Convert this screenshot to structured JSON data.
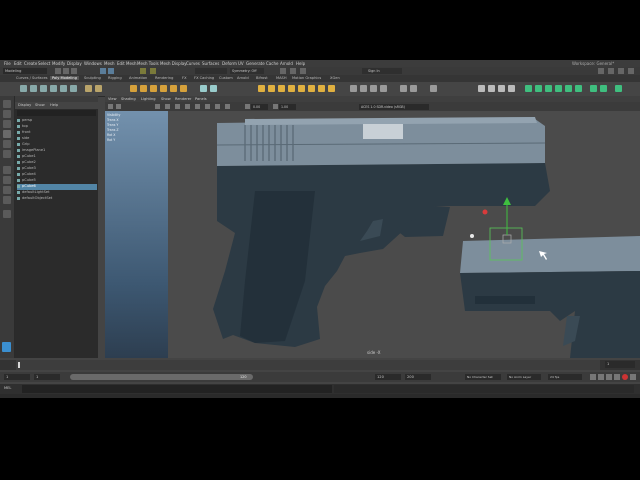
{
  "app": {
    "workspace_value": "Modeling",
    "symmetry_value": "Symmetry: Off",
    "user_value": "Sign In",
    "workspace_right": "Workspace: General*"
  },
  "menubar": [
    "File",
    "Edit",
    "Create",
    "Select",
    "Modify",
    "Display",
    "Windows",
    "Mesh",
    "Edit Mesh",
    "Mesh Tools",
    "Mesh Display",
    "Curves",
    "Surfaces",
    "Deform",
    "UV",
    "Generate",
    "Cache",
    "Arnold",
    "Help"
  ],
  "shelf_tabs": [
    "Curves / Surfaces",
    "Poly Modeling",
    "Sculpting",
    "Rigging",
    "Animation",
    "Rendering",
    "FX",
    "FX Caching",
    "Custom",
    "Arnold",
    "Bifrost",
    "MASH",
    "Motion Graphics",
    "XGen"
  ],
  "outliner": {
    "menu": [
      "Display",
      "Show",
      "Help"
    ],
    "items": [
      {
        "label": "persp",
        "selected": false
      },
      {
        "label": "top",
        "selected": false
      },
      {
        "label": "front",
        "selected": false
      },
      {
        "label": "side",
        "selected": false
      },
      {
        "label": "Grip",
        "selected": false
      },
      {
        "label": "imagePlane1",
        "selected": false
      },
      {
        "label": "pCube1",
        "selected": false
      },
      {
        "label": "pCube2",
        "selected": false
      },
      {
        "label": "pCube3",
        "selected": false
      },
      {
        "label": "pCube4",
        "selected": false
      },
      {
        "label": "pCube5",
        "selected": false
      },
      {
        "label": "pCube6",
        "selected": true
      },
      {
        "label": "defaultLightSet",
        "selected": false
      },
      {
        "label": "defaultObjectSet",
        "selected": false
      }
    ]
  },
  "viewport": {
    "menu": [
      "View",
      "Shading",
      "Lighting",
      "Show",
      "Renderer",
      "Panels"
    ],
    "camera_label": "side -X",
    "field_a": "0.00",
    "field_b": "1.00",
    "colorspace": "ACES 1.0 SDR-video (sRGB)",
    "channel_rows": [
      "Visibility",
      "Trans X",
      "Trans Y",
      "Trans Z",
      "Rot X",
      "Rot Y"
    ]
  },
  "timeline": {
    "start": "1",
    "end": "120",
    "current": "1",
    "range_end": "120",
    "range_end2": "200",
    "char_set": "No Character Set",
    "anim_layer": "No Anim Layer",
    "fps": "24 fps"
  },
  "cmd": {
    "lang": "MEL"
  },
  "colors": {
    "selection": "#5285a6",
    "gun_slide": "#7d8e9c",
    "gun_frame": "#2c3a44",
    "manip_y": "#3fbf3f",
    "manip_x": "#d83b3b"
  }
}
